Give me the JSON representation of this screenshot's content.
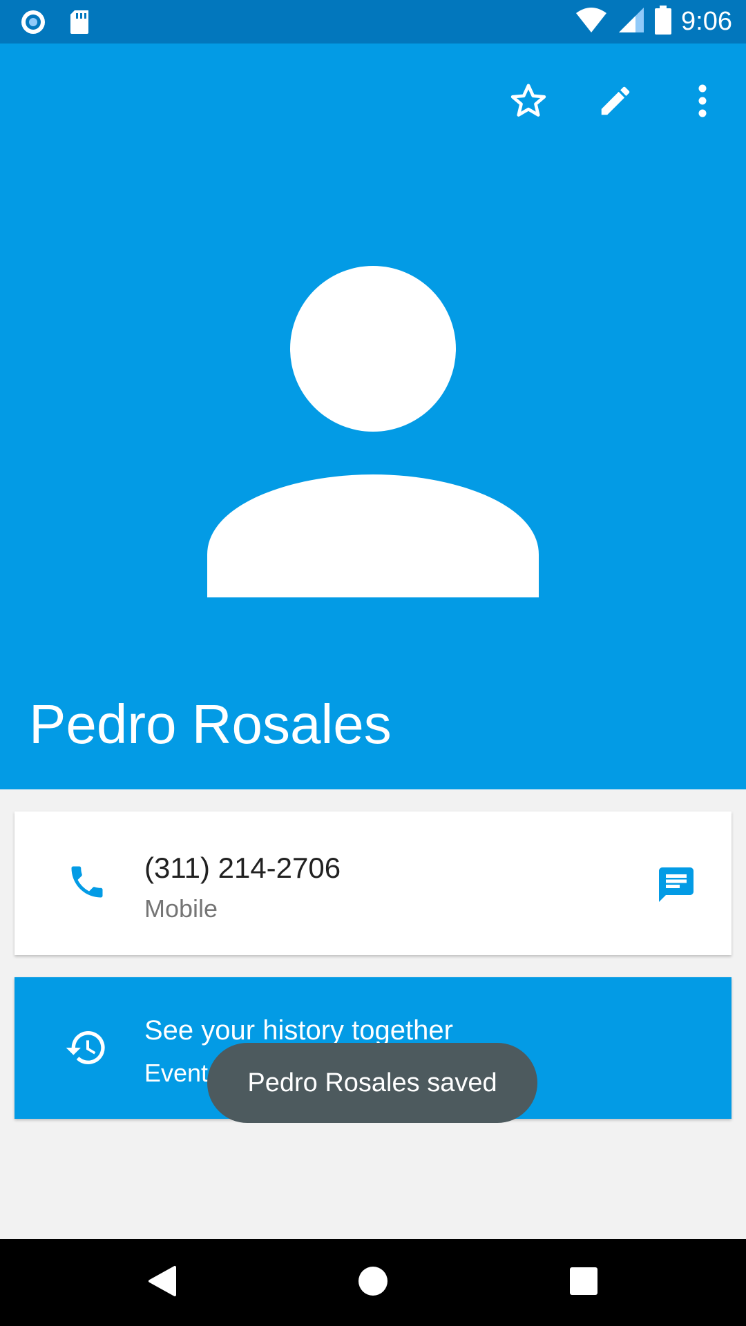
{
  "status_bar": {
    "time": "9:06",
    "icons": [
      "sync-icon",
      "sd-card-icon",
      "wifi-icon",
      "signal-icon",
      "battery-icon"
    ]
  },
  "toolbar": {
    "actions": [
      "star-icon",
      "edit-icon",
      "more-vert-icon"
    ]
  },
  "contact": {
    "name": "Pedro Rosales",
    "phone_number": "(311) 214-2706",
    "phone_type": "Mobile"
  },
  "history": {
    "title": "See your history together",
    "subtitle": "Events and messages"
  },
  "toast": {
    "text": "Pedro Rosales saved"
  },
  "colors": {
    "status_bar": "#0277bd",
    "header": "#039be5",
    "accent": "#039be5",
    "toast": "#4d5a5e"
  }
}
